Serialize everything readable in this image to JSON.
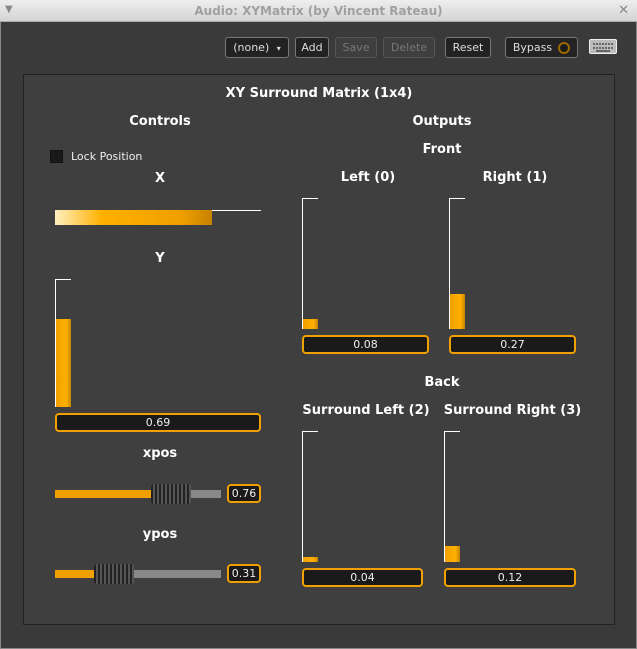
{
  "window": {
    "title": "Audio: XYMatrix (by Vincent Rateau)"
  },
  "toolbar": {
    "preset": "(none)",
    "add": "Add",
    "save": "Save",
    "delete": "Delete",
    "reset": "Reset",
    "bypass": "Bypass"
  },
  "plugin": {
    "title": "XY Surround Matrix (1x4)",
    "controls_heading": "Controls",
    "outputs_heading": "Outputs",
    "lock_position": "Lock Position",
    "lock_checked": false,
    "x": {
      "label": "X",
      "fraction": 0.76
    },
    "y": {
      "label": "Y",
      "value": "0.69",
      "fraction": 0.69
    },
    "xpos": {
      "label": "xpos",
      "value": "0.76",
      "fraction": 0.76
    },
    "ypos": {
      "label": "ypos",
      "value": "0.31",
      "fraction": 0.31
    },
    "front": {
      "heading": "Front",
      "left": {
        "label": "Left (0)",
        "value": "0.08",
        "fraction": 0.08
      },
      "right": {
        "label": "Right (1)",
        "value": "0.27",
        "fraction": 0.27
      }
    },
    "back": {
      "heading": "Back",
      "surround_left": {
        "label": "Surround Left (2)",
        "value": "0.04",
        "fraction": 0.04
      },
      "surround_right": {
        "label": "Surround Right (3)",
        "value": "0.12",
        "fraction": 0.12
      }
    }
  },
  "colors": {
    "accent": "#f0a000",
    "background": "#3a3a3a"
  }
}
